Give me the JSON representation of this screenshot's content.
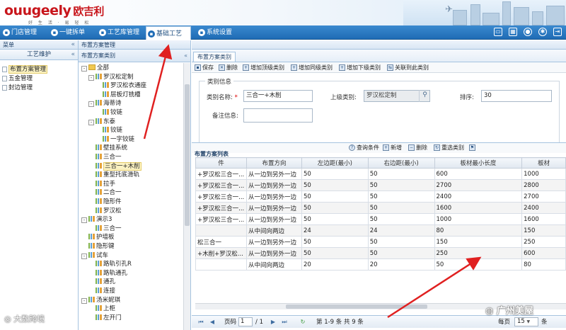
{
  "header": {
    "logo_text": "ugeely",
    "logo_cn": "欧吉利",
    "slogan": "好 生 活 · 易 轻 松"
  },
  "nav": {
    "items": [
      {
        "label": "门店管理",
        "icon": "store-icon"
      },
      {
        "label": "一键拆单",
        "icon": "split-order-icon"
      },
      {
        "label": "工艺库管理",
        "icon": "library-icon"
      },
      {
        "label": "基础工艺",
        "icon": "base-craft-icon",
        "active": true
      },
      {
        "label": "系统设置",
        "icon": "settings-icon"
      }
    ],
    "right_icons": [
      "monitor-icon",
      "grid-icon",
      "user-icon",
      "gear-icon",
      "logout-icon"
    ]
  },
  "left_panel": {
    "title": "菜单",
    "group": "工艺维护",
    "items": [
      {
        "label": "布置方案管理",
        "selected": true
      },
      {
        "label": "五金管理",
        "selected": false
      },
      {
        "label": "封边管理",
        "selected": false
      }
    ]
  },
  "mid_panel": {
    "breadcrumb": "布置方案管理",
    "title": "布置方案类别",
    "tree": [
      {
        "label": "全部",
        "level": 0,
        "toggle": "-",
        "type": "folder"
      },
      {
        "label": "罗汉松定制",
        "level": 1,
        "toggle": "-",
        "type": "node"
      },
      {
        "label": "罗汉松衣通座",
        "level": 2,
        "toggle": "",
        "type": "node"
      },
      {
        "label": "层板灯铣槽",
        "level": 2,
        "toggle": "",
        "type": "node"
      },
      {
        "label": "海蒂诗",
        "level": 1,
        "toggle": "-",
        "type": "node"
      },
      {
        "label": "铰链",
        "level": 2,
        "toggle": "",
        "type": "node"
      },
      {
        "label": "东泰",
        "level": 1,
        "toggle": "-",
        "type": "node"
      },
      {
        "label": "铰链",
        "level": 2,
        "toggle": "",
        "type": "node"
      },
      {
        "label": "一字铰链",
        "level": 2,
        "toggle": "",
        "type": "node"
      },
      {
        "label": "壁挂系统",
        "level": 1,
        "toggle": "",
        "type": "node"
      },
      {
        "label": "三合一",
        "level": 1,
        "toggle": "",
        "type": "node"
      },
      {
        "label": "三合一+木削",
        "level": 1,
        "toggle": "",
        "type": "node",
        "selected": true
      },
      {
        "label": "重型托底滑轨",
        "level": 1,
        "toggle": "",
        "type": "node"
      },
      {
        "label": "拉手",
        "level": 1,
        "toggle": "",
        "type": "node"
      },
      {
        "label": "二合一",
        "level": 1,
        "toggle": "",
        "type": "node"
      },
      {
        "label": "隐形件",
        "level": 1,
        "toggle": "",
        "type": "node"
      },
      {
        "label": "罗汉松",
        "level": 1,
        "toggle": "",
        "type": "node"
      },
      {
        "label": "演示3",
        "level": 0,
        "toggle": "-",
        "type": "node"
      },
      {
        "label": "三合一",
        "level": 1,
        "toggle": "",
        "type": "node"
      },
      {
        "label": "护墙板",
        "level": 0,
        "toggle": "",
        "type": "node"
      },
      {
        "label": "隐形键",
        "level": 0,
        "toggle": "",
        "type": "node"
      },
      {
        "label": "试车",
        "level": 0,
        "toggle": "-",
        "type": "node"
      },
      {
        "label": "路轨引孔R",
        "level": 1,
        "toggle": "",
        "type": "node"
      },
      {
        "label": "路轨通孔",
        "level": 1,
        "toggle": "",
        "type": "node"
      },
      {
        "label": "通孔",
        "level": 1,
        "toggle": "",
        "type": "node"
      },
      {
        "label": "连接",
        "level": 1,
        "toggle": "",
        "type": "node"
      },
      {
        "label": "汤米妮琪",
        "level": 0,
        "toggle": "-",
        "type": "node"
      },
      {
        "label": "上柜",
        "level": 1,
        "toggle": "",
        "type": "node"
      },
      {
        "label": "左开门",
        "level": 1,
        "toggle": "",
        "type": "node"
      }
    ]
  },
  "right_panel": {
    "tab": "布置方案类别",
    "toolbar": [
      {
        "label": "保存",
        "icon": "save-icon"
      },
      {
        "label": "删除",
        "icon": "delete-icon"
      },
      {
        "label": "增加顶级类别",
        "icon": "add-top-icon"
      },
      {
        "label": "增加同级类别",
        "icon": "add-sibling-icon"
      },
      {
        "label": "增加下级类别",
        "icon": "add-child-icon"
      },
      {
        "label": "关联到此类别",
        "icon": "link-icon"
      }
    ],
    "form": {
      "legend": "类别信息",
      "name_label": "类别名称:",
      "name_value": "三合一+木削",
      "parent_label": "上级类别:",
      "parent_value": "罗汉松定制",
      "sort_label": "排序:",
      "sort_value": "30",
      "remark_label": "备注信息:",
      "remark_value": ""
    },
    "grid_tools": [
      {
        "label": "查询条件",
        "icon": "query-icon"
      },
      {
        "label": "新增",
        "icon": "add-icon"
      },
      {
        "label": "删除",
        "icon": "delete-icon"
      },
      {
        "label": "重选类别",
        "icon": "reselect-icon"
      }
    ],
    "grid_title": "布置方案列表",
    "columns": [
      "件",
      "布置方向",
      "左边距(最小)",
      "右边距(最小)",
      "板材最小长度",
      "板材"
    ],
    "rows": [
      [
        "+罗汉松三合一...",
        "从一边到另外一边",
        "50",
        "50",
        "600",
        "1000"
      ],
      [
        "+罗汉松三合一...",
        "从一边到另外一边",
        "50",
        "50",
        "2700",
        "2800"
      ],
      [
        "+罗汉松三合一...",
        "从一边到另外一边",
        "50",
        "50",
        "2400",
        "2700"
      ],
      [
        "+罗汉松三合一...",
        "从一边到另外一边",
        "50",
        "50",
        "1600",
        "2400"
      ],
      [
        "+罗汉松三合一...",
        "从一边到另外一边",
        "50",
        "50",
        "1000",
        "1600"
      ],
      [
        "",
        "从中间向两边",
        "24",
        "24",
        "80",
        "150"
      ],
      [
        "松三合一",
        "从一边到另外一边",
        "50",
        "50",
        "150",
        "250"
      ],
      [
        "+木削+罗汉松...",
        "从一边到另外一边",
        "50",
        "50",
        "250",
        "600"
      ],
      [
        "",
        "从中间向两边",
        "20",
        "20",
        "50",
        "80"
      ]
    ],
    "pager": {
      "page_label": "页码",
      "page_value": "1",
      "page_total": "/ 1",
      "summary": "第 1-9 条  共 9 条",
      "per_page_label": "每页",
      "per_page_value": "15",
      "per_page_unit": "条"
    }
  },
  "watermarks": {
    "left": "大数跨境",
    "right": "广州美屋"
  }
}
